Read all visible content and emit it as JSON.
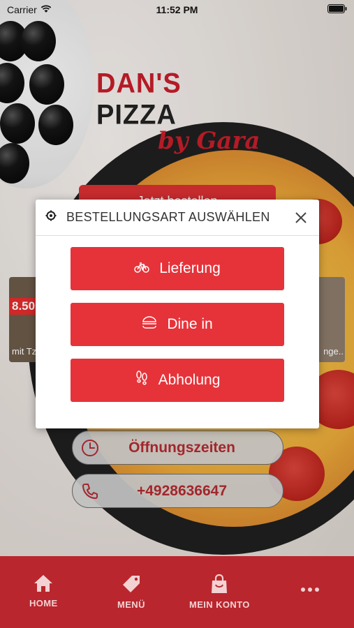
{
  "status_bar": {
    "carrier": "Carrier",
    "time": "11:52 PM"
  },
  "logo": {
    "word1": "DAN'S",
    "word2": "PIZZA",
    "sub": "by Gara"
  },
  "background": {
    "order_button_label": "Jetzt bestellen",
    "card_left_price": "8.50",
    "card_left_caption": "mit Tz",
    "card_right_caption": "nge..",
    "hours_label": "Öffnungszeiten",
    "phone_label": "+4928636647"
  },
  "modal": {
    "title": "BESTELLUNGSART AUSWÄHLEN",
    "options": [
      {
        "label": "Lieferung",
        "icon": "bicycle-icon"
      },
      {
        "label": "Dine in",
        "icon": "burger-icon"
      },
      {
        "label": "Abholung",
        "icon": "footprints-icon"
      }
    ]
  },
  "nav": {
    "items": [
      {
        "label": "HOME",
        "icon": "home-icon"
      },
      {
        "label": "MENÜ",
        "icon": "tag-icon"
      },
      {
        "label": "MEIN KONTO",
        "icon": "shopping-bag-icon"
      },
      {
        "label": "",
        "icon": "more-icon"
      }
    ]
  },
  "colors": {
    "accent": "#e6333a",
    "nav_bg": "#b9262d",
    "brand_red": "#c41e2a"
  }
}
